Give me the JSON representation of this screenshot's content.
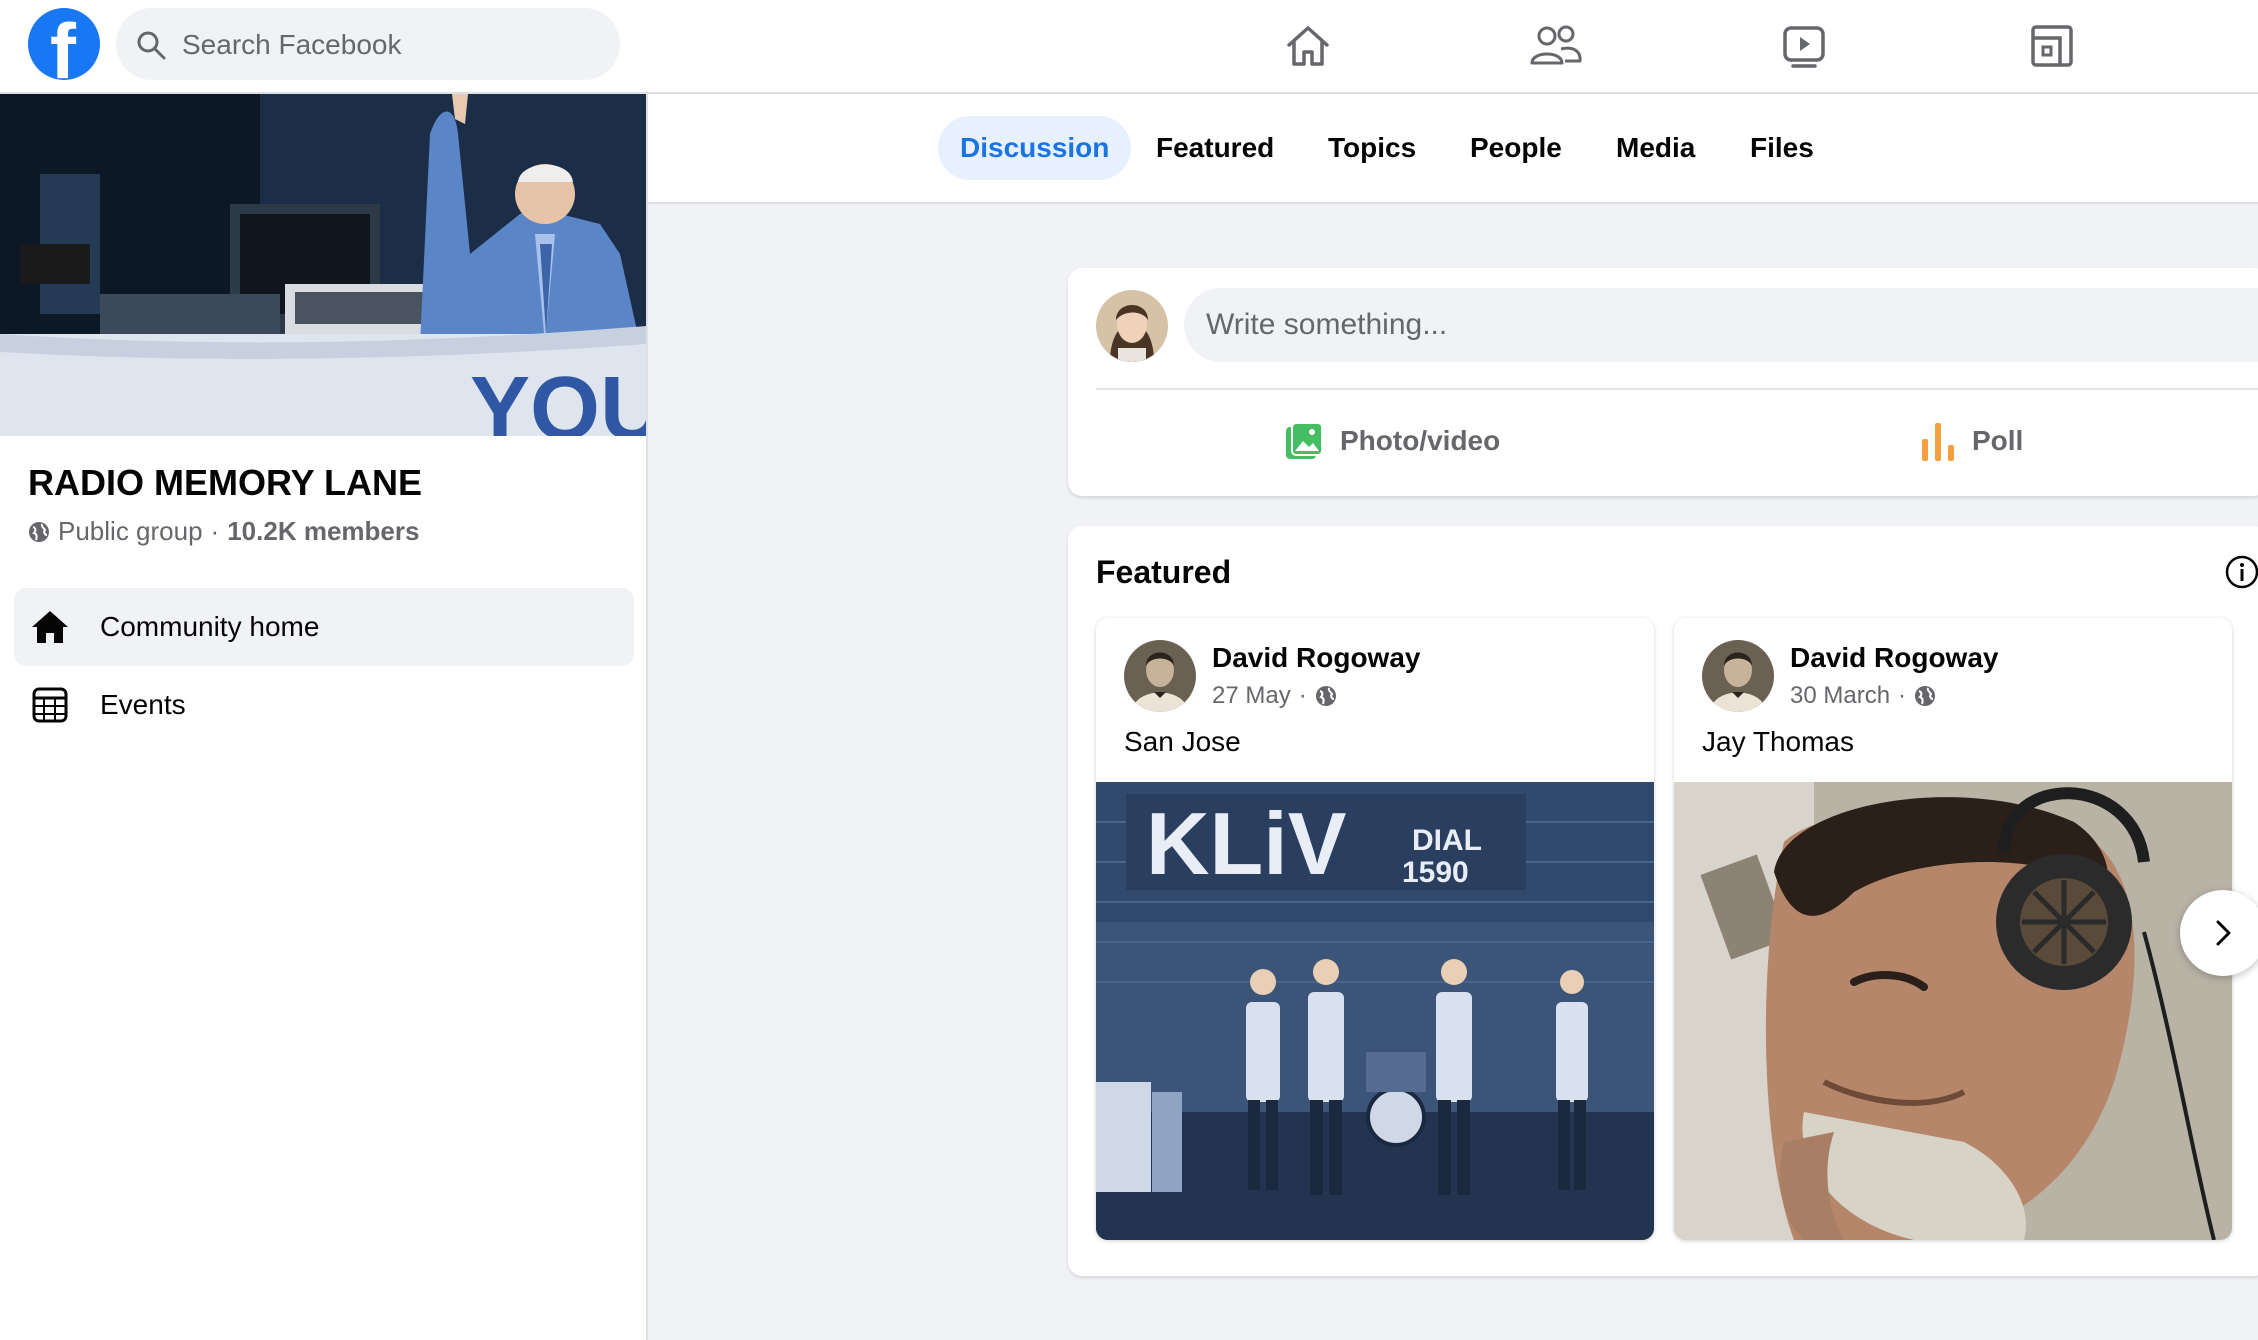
{
  "topbar": {
    "logo_letter": "f",
    "search_placeholder": "Search Facebook",
    "nav_icons": [
      "home-icon",
      "friends-icon",
      "watch-icon",
      "gaming-icon"
    ]
  },
  "colors": {
    "brand": "#1877f2",
    "active_tab_bg": "#e7f0fd",
    "active_tab_text": "#1b74e4",
    "photo_icon": "#45bd62",
    "poll_icon": "#f5a03c"
  },
  "group": {
    "name": "RADIO MEMORY LANE",
    "privacy": "Public group",
    "separator": "·",
    "members": "10.2K members"
  },
  "sidebar": {
    "items": [
      {
        "label": "Community home",
        "icon": "home-icon",
        "active": true
      },
      {
        "label": "Events",
        "icon": "calendar-icon",
        "active": false
      }
    ]
  },
  "tabs": [
    {
      "label": "Discussion",
      "active": true
    },
    {
      "label": "Featured",
      "active": false
    },
    {
      "label": "Topics",
      "active": false
    },
    {
      "label": "People",
      "active": false
    },
    {
      "label": "Media",
      "active": false
    },
    {
      "label": "Files",
      "active": false
    }
  ],
  "composer": {
    "placeholder": "Write something...",
    "photo_label": "Photo/video",
    "poll_label": "Poll"
  },
  "featured": {
    "title": "Featured",
    "posts": [
      {
        "author": "David Rogoway",
        "date": "27 May",
        "dot": "·",
        "text": "San Jose"
      },
      {
        "author": "David Rogoway",
        "date": "30 March",
        "dot": "·",
        "text": "Jay Thomas"
      }
    ]
  },
  "photo1": {
    "sign_main": "KLiV",
    "sign_dial": "DIAL",
    "sign_freq": "1590"
  },
  "cover_banner_text": "YOU"
}
